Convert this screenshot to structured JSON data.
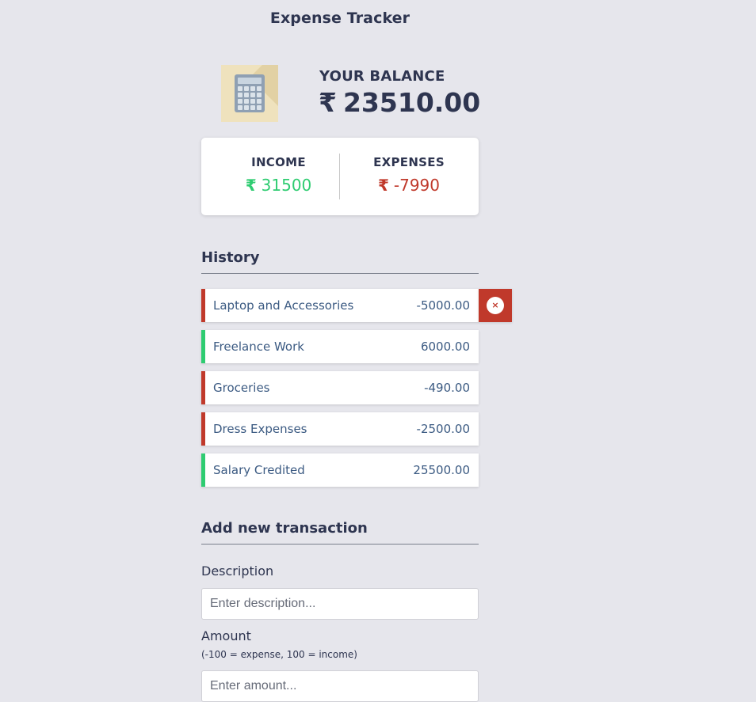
{
  "app": {
    "title": "Expense Tracker"
  },
  "balance": {
    "label": "YOUR BALANCE",
    "currency": "₹",
    "value": "23510.00"
  },
  "summary": {
    "income_label": "INCOME",
    "income_currency": "₹",
    "income_value": "31500",
    "expense_label": "EXPENSES",
    "expense_currency": "₹",
    "expense_value": "-7990"
  },
  "history": {
    "title": "History",
    "items": [
      {
        "text": "Laptop and Accessories",
        "amount": "-5000.00",
        "type": "minus"
      },
      {
        "text": "Freelance Work",
        "amount": "6000.00",
        "type": "plus"
      },
      {
        "text": "Groceries",
        "amount": "-490.00",
        "type": "minus"
      },
      {
        "text": "Dress Expenses",
        "amount": "-2500.00",
        "type": "minus"
      },
      {
        "text": "Salary Credited",
        "amount": "25500.00",
        "type": "plus"
      }
    ],
    "delete_glyph": "×"
  },
  "form": {
    "title": "Add new transaction",
    "description_label": "Description",
    "description_placeholder": "Enter description...",
    "amount_label": "Amount",
    "amount_hint": "(-100 = expense, 100 = income)",
    "amount_placeholder": "Enter amount..."
  },
  "colors": {
    "background": "#e6e6ec",
    "income": "#2ecc71",
    "expense": "#c0392b",
    "text": "#2e3550"
  },
  "icons": {
    "logo": "calculator-icon",
    "delete": "close-icon"
  }
}
